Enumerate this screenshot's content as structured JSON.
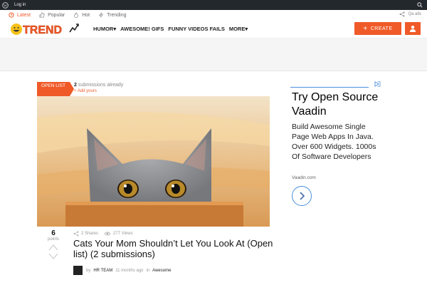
{
  "adminbar": {
    "login": "Log in"
  },
  "subnav": {
    "items": [
      {
        "label": "Latest"
      },
      {
        "label": "Popular"
      },
      {
        "label": "Hot"
      },
      {
        "label": "Trending"
      }
    ],
    "right_label": "Qa alls"
  },
  "header": {
    "logo_text": "TREND",
    "nav": [
      "HUMOR▾",
      "AWESOME! GIFS",
      "FUNNY VIDEOS FAILS",
      "MORE▾"
    ],
    "create_label": "CREATE",
    "accent": "#f05a28"
  },
  "post": {
    "badge": "OPEN LIST",
    "submissions_count": "2",
    "submissions_text": "submissions already",
    "add_yours": "+ Add yours",
    "points": "6",
    "points_label": "points",
    "shares": "2 Shares",
    "views": "277 Views",
    "title": "Cats Your Mom Shouldn’t Let You Look At (Open list) (2 submissions)",
    "author": "HR TEAM",
    "time": "11 months ago",
    "in_label": "in",
    "category": "Awesome"
  },
  "ad": {
    "headline": "Try Open Source Vaadin",
    "body": "Build Awesome Single Page Web Apps In Java. Over 600 Widgets. 1000s Of Software Developers",
    "source": "Vaadin.com"
  }
}
